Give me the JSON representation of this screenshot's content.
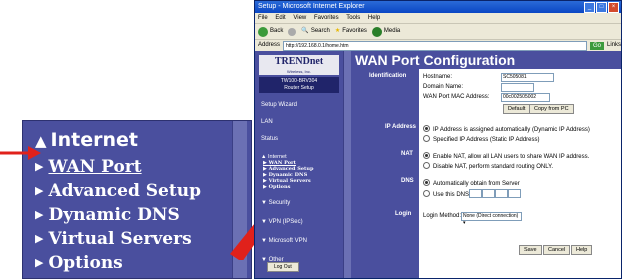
{
  "zoom": {
    "section": "Internet",
    "items": [
      "WAN Port",
      "Advanced Setup",
      "Dynamic DNS",
      "Virtual Servers",
      "Options"
    ]
  },
  "browser": {
    "title": "Setup - Microsoft Internet Explorer",
    "menu": [
      "File",
      "Edit",
      "View",
      "Favorites",
      "Tools",
      "Help"
    ],
    "toolbar": [
      "Back",
      "Search",
      "Favorites",
      "Media"
    ],
    "address_label": "Address",
    "address": "http://192.168.0.1/home.htm",
    "go": "Go",
    "links": "Links"
  },
  "router": {
    "brand": "TRENDnet",
    "brand_tag": "Wireless, Inc.",
    "model": "TW100-BRV304",
    "model_sub": "Router Setup",
    "nav_top": [
      "Setup Wizard",
      "LAN",
      "Status"
    ],
    "internet_head": "Internet",
    "internet_items": [
      "WAN Port",
      "Advanced Setup",
      "Dynamic DNS",
      "Virtual Servers",
      "Options"
    ],
    "nav_bottom": [
      "Security",
      "VPN (IPSec)",
      "Microsoft VPN",
      "Other"
    ],
    "logout": "Log Out",
    "page_title": "WAN Port Configuration",
    "sections": {
      "identification": "Identification",
      "ip_address": "IP Address",
      "nat": "NAT",
      "dns": "DNS",
      "login": "Login"
    },
    "hostname_label": "Hostname:",
    "hostname_value": "SC505081",
    "domain_label": "Domain Name:",
    "domain_value": "",
    "mac_label": "WAN Port MAC Address:",
    "mac_value": "00c002505002",
    "default_btn": "Default",
    "copy_btn": "Copy from PC",
    "ip_auto": "IP Address is assigned automatically (Dynamic IP Address)",
    "ip_static": "Specified IP Address (Static IP Address)",
    "nat_enable": "Enable NAT, allow all LAN users to share WAN IP address.",
    "nat_disable": "Disable NAT, perform standard routing ONLY.",
    "dns_auto": "Automatically obtain from Server",
    "dns_use": "Use this DNS",
    "login_label": "Login Method:",
    "login_value": "None (Direct connection)",
    "save_btn": "Save",
    "cancel_btn": "Cancel",
    "help_btn": "Help"
  },
  "colors": {
    "panel": "#4a4f9e",
    "arrow": "#e0211b"
  }
}
